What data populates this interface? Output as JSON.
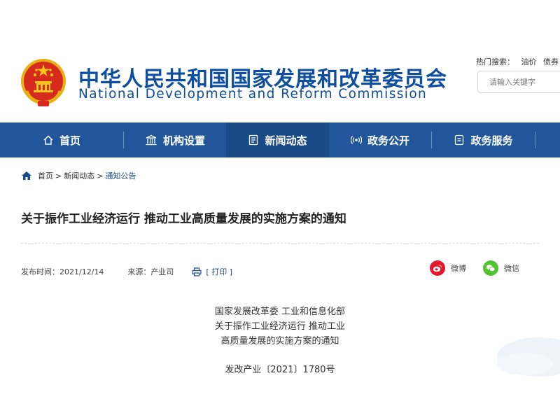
{
  "header": {
    "title_cn": "中华人民共和国国家发展和改革委员会",
    "title_en": "National Development and Reform Commission",
    "hot_search": {
      "label": "热门搜索：",
      "items": [
        "油价",
        "债券"
      ]
    },
    "search": {
      "placeholder": "请输入关键字"
    }
  },
  "nav": {
    "items": [
      {
        "label": "首页",
        "icon": "home-icon"
      },
      {
        "label": "机构设置",
        "icon": "building-icon"
      },
      {
        "label": "新闻动态",
        "icon": "news-icon",
        "active": true
      },
      {
        "label": "政务公开",
        "icon": "broadcast-icon"
      },
      {
        "label": "政务服务",
        "icon": "service-icon"
      }
    ]
  },
  "breadcrumb": {
    "items": [
      "首页",
      "新闻动态",
      "通知公告"
    ],
    "separator": ">"
  },
  "article": {
    "title": "关于振作工业经济运行 推动工业高质量发展的实施方案的通知",
    "publish_label": "发布时间：",
    "publish_date": "2021/12/14",
    "source_label": "来源：",
    "source": "产业司",
    "print_label": "[ 打印 ]",
    "share": [
      {
        "label": "微博",
        "icon": "weibo-icon",
        "color": "#e6162d"
      },
      {
        "label": "微信",
        "icon": "wechat-icon",
        "color": "#51c332"
      }
    ],
    "heading_lines": [
      "国家发展改革委 工业和信息化部",
      "关于振作工业经济运行 推动工业",
      "高质量发展的实施方案的通知"
    ],
    "doc_number": "发改产业〔2021〕1780号"
  },
  "colors": {
    "nav_bg": "#22569a",
    "brand_blue": "#0d4ea0",
    "nav_active": "#1b4a88"
  }
}
